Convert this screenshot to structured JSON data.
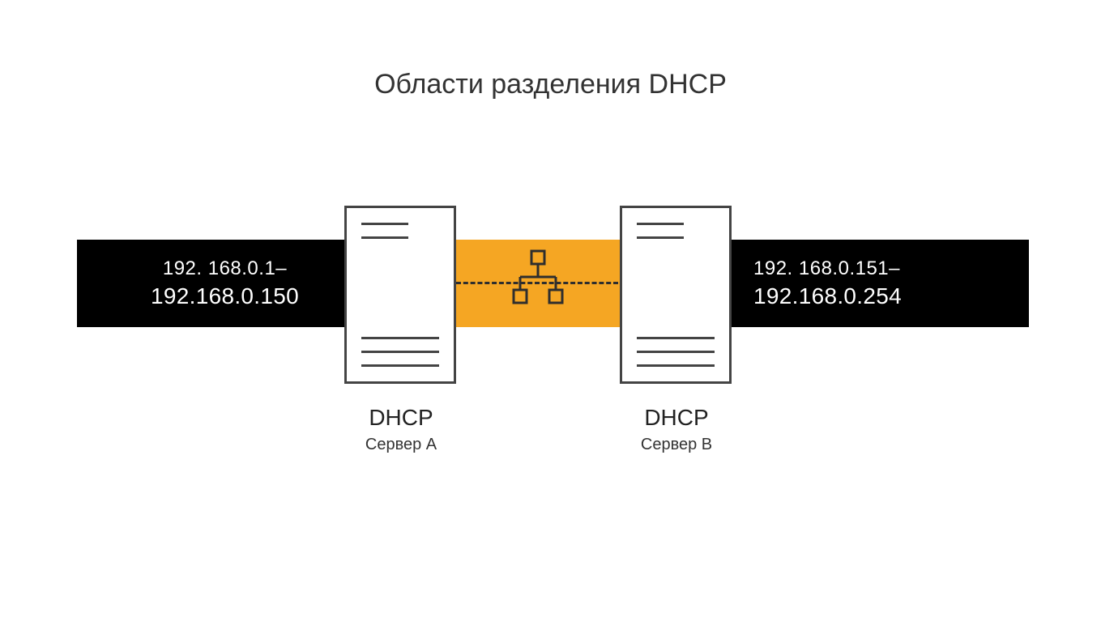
{
  "title": "Области разделения DHCP",
  "left_range": {
    "start": "192. 168.0.1–",
    "end": "192.168.0.150"
  },
  "right_range": {
    "start": "192. 168.0.151–",
    "end": "192.168.0.254"
  },
  "server_a": {
    "name": "DHCP",
    "subtitle": "Сервер A"
  },
  "server_b": {
    "name": "DHCP",
    "subtitle": "Сервер B"
  },
  "colors": {
    "accent": "#f5a623",
    "bar": "#000000",
    "stroke": "#444444"
  }
}
